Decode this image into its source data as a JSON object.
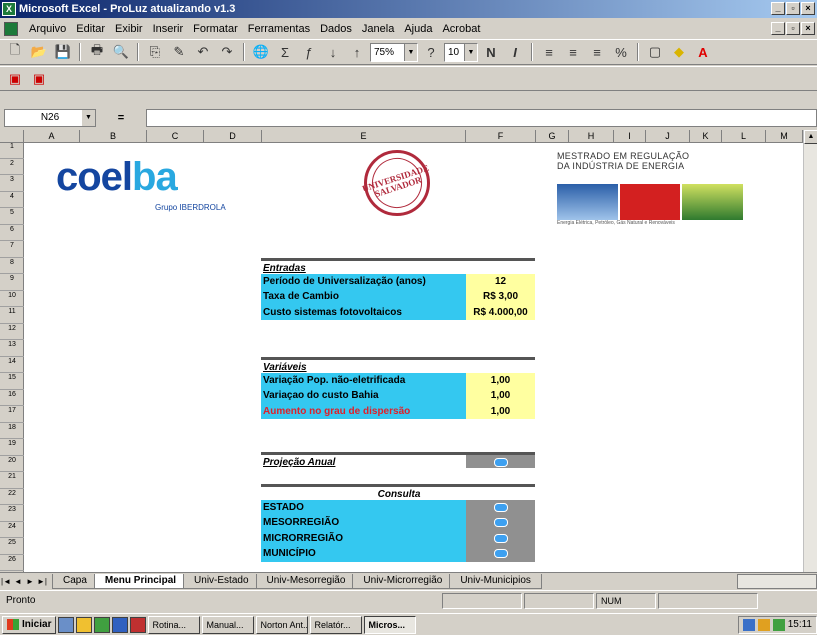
{
  "window": {
    "title": "Microsoft Excel - ProLuz atualizando v1.3"
  },
  "menu": [
    "Arquivo",
    "Editar",
    "Exibir",
    "Inserir",
    "Formatar",
    "Ferramentas",
    "Dados",
    "Janela",
    "Ajuda",
    "Acrobat"
  ],
  "toolbar": {
    "zoom": "75%",
    "font_size": "10",
    "bold": "N",
    "italic": "I"
  },
  "formula_bar": {
    "name_box": "N26",
    "equals": "=",
    "formula": ""
  },
  "columns": [
    "A",
    "B",
    "C",
    "D",
    "E",
    "F",
    "G",
    "H",
    "I",
    "J",
    "K",
    "L",
    "M"
  ],
  "rows": [
    "1",
    "2",
    "3",
    "4",
    "5",
    "6",
    "7",
    "8",
    "9",
    "10",
    "11",
    "12",
    "13",
    "14",
    "15",
    "16",
    "17",
    "18",
    "19",
    "20",
    "21",
    "22",
    "23",
    "24",
    "25",
    "26"
  ],
  "logos": {
    "coelba": {
      "text_a": "coel",
      "text_b": "ba",
      "sub": "Grupo IBERDROLA"
    },
    "seal": {
      "line1": "UNIVERSIDADE",
      "line2": "SALVADOR"
    },
    "mestrado": {
      "line1": "MESTRADO EM REGULAÇÃO",
      "line2": "DA INDÚSTRIA DE ENERGIA",
      "sub": "Energia Elétrica, Petróleo, Gás Natural e Renováveis"
    }
  },
  "entradas": {
    "header": "Entradas",
    "rows": [
      {
        "label": "Período de Universalização (anos)",
        "value": "12"
      },
      {
        "label": "Taxa de Cambio",
        "value": "R$ 3,00"
      },
      {
        "label": "Custo sistemas fotovoltaicos",
        "value": "R$ 4.000,00"
      }
    ]
  },
  "variaveis": {
    "header": "Variáveis",
    "rows": [
      {
        "label": "Variação Pop. não-eletrificada",
        "value": "1,00"
      },
      {
        "label": "Variaçao do custo Bahia",
        "value": "1,00"
      },
      {
        "label": "Aumento no grau de dispersão",
        "value": "1,00"
      }
    ]
  },
  "projecao": {
    "label": "Projeção Anual"
  },
  "consulta": {
    "header": "Consulta",
    "rows": [
      "ESTADO",
      "MESORREGIÃO",
      "MICRORREGIÃO",
      "MUNICÍPIO"
    ]
  },
  "sheet_tabs": [
    "Capa",
    "Menu Principal",
    "Univ-Estado",
    "Univ-Mesorregião",
    "Univ-Microrregião",
    "Univ-Municipios"
  ],
  "active_tab": "Menu Principal",
  "status": {
    "text": "Pronto",
    "num": "NUM"
  },
  "taskbar": {
    "start": "Iniciar",
    "tasks": [
      "Rotina...",
      "Manual...",
      "Norton Ant...",
      "Relatór...",
      "Micros..."
    ],
    "clock": "15:11"
  }
}
